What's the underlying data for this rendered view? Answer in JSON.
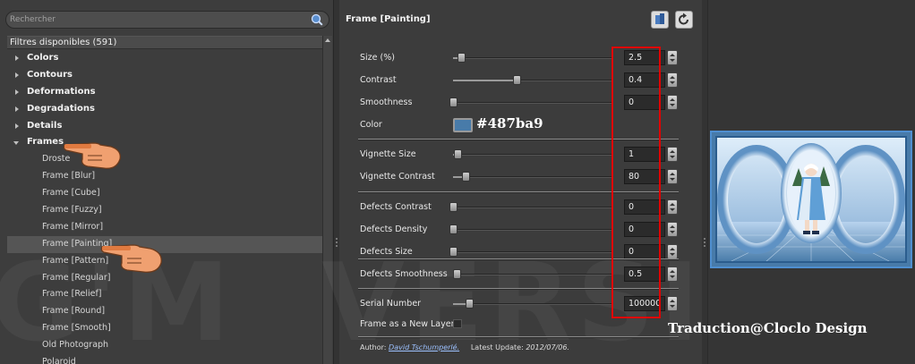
{
  "search": {
    "placeholder": "Rechercher"
  },
  "filters": {
    "header": "Filtres disponibles (591)",
    "tree": [
      {
        "label": "Colors",
        "type": "category",
        "expanded": false
      },
      {
        "label": "Contours",
        "type": "category",
        "expanded": false
      },
      {
        "label": "Deformations",
        "type": "category",
        "expanded": false
      },
      {
        "label": "Degradations",
        "type": "category",
        "expanded": false
      },
      {
        "label": "Details",
        "type": "category",
        "expanded": false
      },
      {
        "label": "Frames",
        "type": "category",
        "expanded": true
      },
      {
        "label": "Droste",
        "type": "item"
      },
      {
        "label": "Frame [Blur]",
        "type": "item"
      },
      {
        "label": "Frame [Cube]",
        "type": "item"
      },
      {
        "label": "Frame [Fuzzy]",
        "type": "item"
      },
      {
        "label": "Frame [Mirror]",
        "type": "item"
      },
      {
        "label": "Frame [Painting]",
        "type": "item",
        "selected": true
      },
      {
        "label": "Frame [Pattern]",
        "type": "item"
      },
      {
        "label": "Frame [Regular]",
        "type": "item"
      },
      {
        "label": "Frame [Relief]",
        "type": "item"
      },
      {
        "label": "Frame [Round]",
        "type": "item"
      },
      {
        "label": "Frame [Smooth]",
        "type": "item"
      },
      {
        "label": "Old Photograph",
        "type": "item"
      },
      {
        "label": "Polaroid",
        "type": "item"
      }
    ]
  },
  "panel": {
    "title": "Frame [Painting]",
    "params": [
      {
        "label": "Size (%)",
        "value": "2.5",
        "level": 0.05
      },
      {
        "label": "Contrast",
        "value": "0.4",
        "level": 0.4
      },
      {
        "label": "Smoothness",
        "value": "0",
        "level": 0
      },
      {
        "label": "Color",
        "color": "#487ba9",
        "annotation": "#487ba9"
      },
      {
        "label": "Vignette Size",
        "value": "1",
        "level": 0.03
      },
      {
        "label": "Vignette Contrast",
        "value": "80",
        "level": 0.08
      },
      {
        "label": "Defects Contrast",
        "value": "0",
        "level": 0
      },
      {
        "label": "Defects Density",
        "value": "0",
        "level": 0
      },
      {
        "label": "Defects Size",
        "value": "0",
        "level": 0
      },
      {
        "label": "Defects Smoothness",
        "value": "0.5",
        "level": 0.02
      },
      {
        "label": "Serial Number",
        "value": "100000",
        "level": 0.1
      },
      {
        "label": "Frame as a New Layer",
        "checkbox": true,
        "checked": false
      }
    ],
    "author_label": "Author:",
    "author_name": "David Tschumperlé.",
    "update_label": "Latest Update:",
    "update_date": "2012/07/06."
  },
  "credit": "Traduction@Cloclo Design",
  "colors": {
    "highlight": "#e20000",
    "accent": "#487ba9",
    "preview_border": "#4f8fd0"
  }
}
